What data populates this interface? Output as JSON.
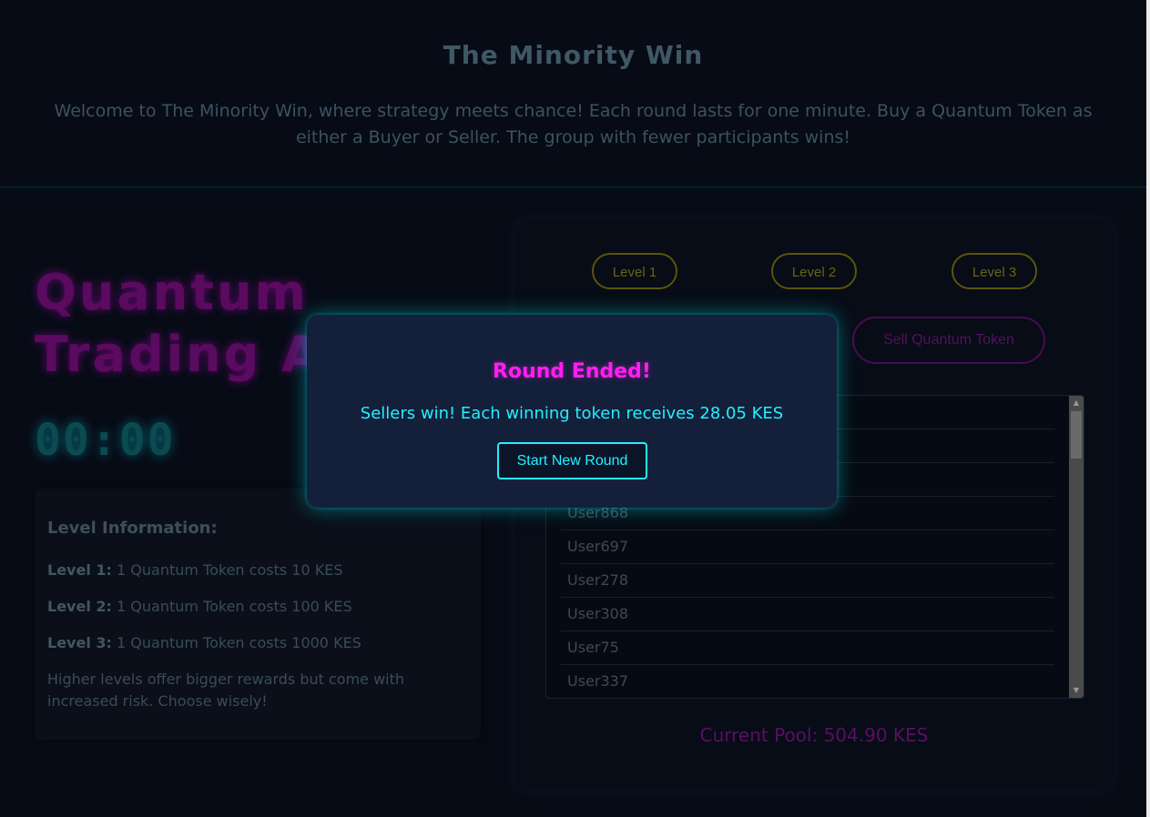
{
  "header": {
    "title": "The Minority Win",
    "intro": "Welcome to The Minority Win, where strategy meets chance! Each round lasts for one minute. Buy a Quantum Token as either a Buyer or Seller. The group with fewer participants wins!"
  },
  "arena": {
    "title_line1": "Quantum",
    "title_line2": "Trading A",
    "timer": "00:00"
  },
  "level_info": {
    "heading": "Level Information:",
    "levels": [
      {
        "label": "Level 1:",
        "text": " 1 Quantum Token costs 10 KES"
      },
      {
        "label": "Level 2:",
        "text": " 1 Quantum Token costs 100 KES"
      },
      {
        "label": "Level 3:",
        "text": " 1 Quantum Token costs 1000 KES"
      }
    ],
    "note": "Higher levels offer bigger rewards but come with increased risk. Choose wisely!"
  },
  "trade_panel": {
    "level_buttons": [
      "Level 1",
      "Level 2",
      "Level 3"
    ],
    "sell_button": "Sell Quantum Token",
    "users": [
      "",
      "",
      "",
      "User868",
      "User697",
      "User278",
      "User308",
      "User75",
      "User337"
    ],
    "pool": "Current Pool: 504.90 KES"
  },
  "modal": {
    "title": "Round Ended!",
    "message": "Sellers win! Each winning token receives 28.05 KES",
    "button": "Start New Round"
  },
  "colors": {
    "background": "#070b16",
    "neon_pink": "#ff1ff1",
    "neon_cyan": "#22f0ff",
    "neon_yellow": "#6a6414"
  }
}
